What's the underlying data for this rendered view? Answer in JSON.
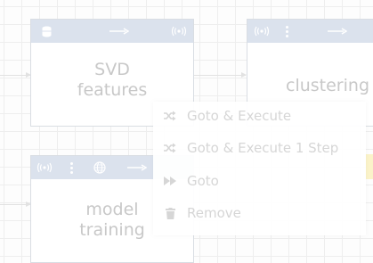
{
  "nodes": {
    "svd": {
      "title_line1": "SVD",
      "title_line2": "features",
      "icons": [
        "database-icon",
        "arrow-right-icon",
        "broadcast-icon"
      ]
    },
    "clustering": {
      "title": "clustering",
      "icons": [
        "broadcast-icon",
        "grip-icon",
        "arrow-right-icon"
      ]
    },
    "model_training": {
      "title_line1": "model",
      "title_line2": "training",
      "icons": [
        "broadcast-icon",
        "grip-icon",
        "globe-icon",
        "arrow-right-icon"
      ]
    }
  },
  "context_menu": {
    "items": [
      {
        "label": "Goto & Execute",
        "icon": "shuffle-icon"
      },
      {
        "label": "Goto & Execute 1 Step",
        "icon": "shuffle-icon"
      },
      {
        "label": "Goto",
        "icon": "fast-forward-icon"
      },
      {
        "label": "Remove",
        "icon": "trash-icon"
      }
    ]
  },
  "colors": {
    "node_header": "#dbe2ed",
    "node_border": "#d9dde3",
    "menu_text": "#d6d6d6",
    "title_text": "#c8c8c8",
    "accent_yellow": "#fbf3c9"
  }
}
